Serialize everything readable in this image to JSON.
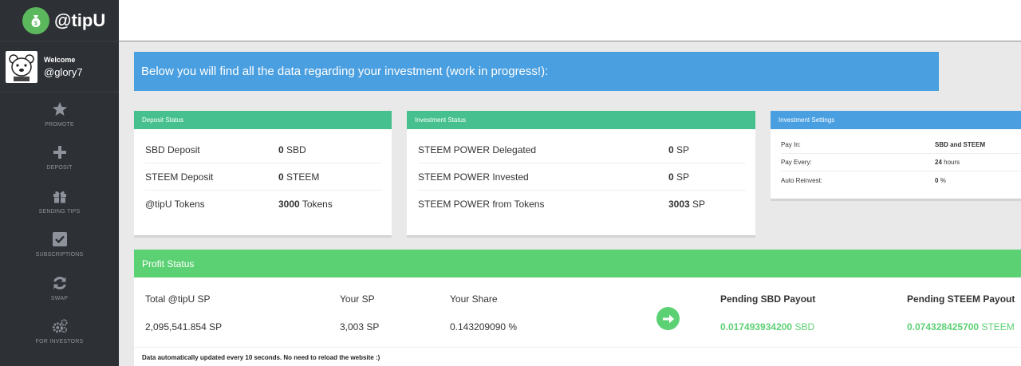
{
  "brand": {
    "name": "@tipU",
    "icon": "money-bag-icon",
    "accent": "#5cb85c"
  },
  "user": {
    "welcome": "Welcome",
    "username": "@glory7",
    "avatar_icon": "bear-avatar"
  },
  "nav": [
    {
      "label": "PROMOTE",
      "icon": "star-icon"
    },
    {
      "label": "DEPOSIT",
      "icon": "plus-icon"
    },
    {
      "label": "SENDING TIPS",
      "icon": "gift-icon"
    },
    {
      "label": "SUBSCRIPTIONS",
      "icon": "checkbox-icon"
    },
    {
      "label": "SWAP",
      "icon": "refresh-icon"
    },
    {
      "label": "FOR INVESTORS",
      "icon": "gears-icon"
    }
  ],
  "banner": {
    "text": "Below you will find all the data regarding your investment (work in progress!):"
  },
  "deposit": {
    "title": "Deposit Status",
    "rows": [
      {
        "label": "SBD Deposit",
        "value": "0",
        "unit": "SBD"
      },
      {
        "label": "STEEM Deposit",
        "value": "0",
        "unit": "STEEM"
      },
      {
        "label": "@tipU Tokens",
        "value": "3000",
        "unit": "Tokens"
      }
    ]
  },
  "investment": {
    "title": "Investment Status",
    "rows": [
      {
        "label": "STEEM POWER Delegated",
        "value": "0",
        "unit": "SP"
      },
      {
        "label": "STEEM POWER Invested",
        "value": "0",
        "unit": "SP"
      },
      {
        "label": "STEEM POWER from Tokens",
        "value": "3003",
        "unit": "SP"
      }
    ]
  },
  "settings": {
    "title": "Investment Settings",
    "rows": [
      {
        "label": "Pay In:",
        "value": "SBD and STEEM",
        "unit": ""
      },
      {
        "label": "Pay Every:",
        "value": "24",
        "unit": "hours"
      },
      {
        "label": "Auto Reinvest:",
        "value": "0",
        "unit": "%"
      }
    ]
  },
  "profit": {
    "title": "Profit Status",
    "total_label": "Total @tipU SP",
    "total_value": "2,095,541.854 SP",
    "your_sp_label": "Your SP",
    "your_sp_value": "3,003 SP",
    "share_label": "Your Share",
    "share_value": "0.143209090 %",
    "sbd_label": "Pending SBD Payout",
    "sbd_value": "0.017493934200",
    "sbd_unit": "SBD",
    "steem_label": "Pending STEEM Payout",
    "steem_value": "0.074328425700",
    "steem_unit": "STEEM",
    "note": "Data automatically updated every 10 seconds. No need to reload the website :)"
  },
  "colors": {
    "sidebar": "#2d3035",
    "blue": "#4a9fe0",
    "teal": "#46c08f",
    "green": "#5cd174"
  }
}
